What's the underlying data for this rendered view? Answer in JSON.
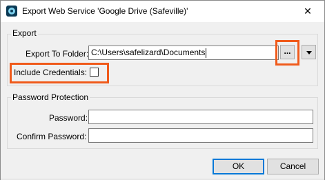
{
  "window": {
    "title": "Export Web Service 'Google Drive (Safeville)'",
    "app_icon": "app-logo-icon",
    "close_glyph": "✕"
  },
  "export_group": {
    "title": "Export",
    "folder_label": "Export To Folder:",
    "folder_value": "C:\\Users\\safelizard\\Documents",
    "browse_label": "...",
    "dropdown_icon": "chevron-down-icon",
    "include_credentials_label": "Include Credentials:",
    "include_credentials_checked": false
  },
  "password_group": {
    "title": "Password Protection",
    "password_label": "Password:",
    "password_value": "",
    "confirm_label": "Confirm Password:",
    "confirm_value": ""
  },
  "buttons": {
    "ok": "OK",
    "cancel": "Cancel"
  },
  "colors": {
    "highlight": "#f05a1a",
    "default_button_border": "#0078d7",
    "dialog_background": "#f0f0f0"
  }
}
